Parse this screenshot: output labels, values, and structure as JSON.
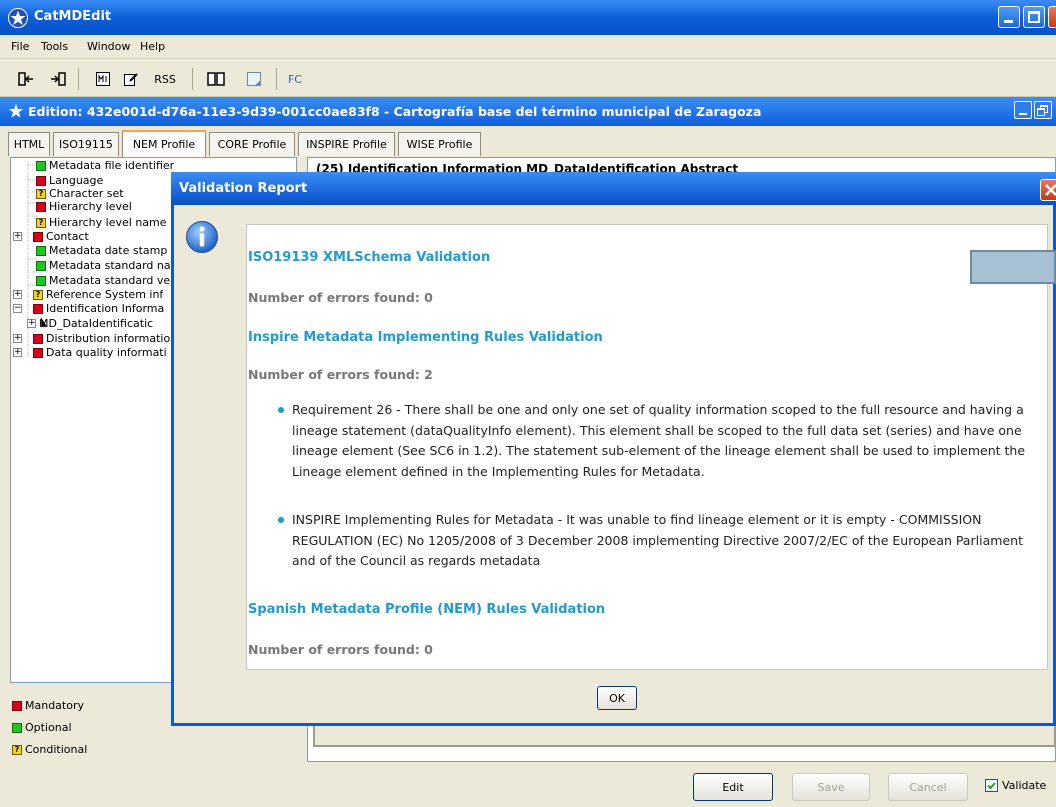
{
  "window": {
    "title": "CatMDEdit"
  },
  "menu": [
    "File",
    "Tools",
    "Window",
    "Help"
  ],
  "toolbar": {
    "rss": "RSS",
    "fc": "FC"
  },
  "edition": {
    "title": "Edition: 432e001d-d76a-11e3-9d39-001cc0ae83f8 - Cartografía base del término municipal de Zaragoza"
  },
  "tabs": [
    "HTML",
    "ISO19115",
    "NEM Profile",
    "CORE Profile",
    "INSPIRE Profile",
    "WISE Profile"
  ],
  "active_tab": "NEM Profile",
  "tree": [
    {
      "label": "Metadata file identifier",
      "status": "optional"
    },
    {
      "label": "Language",
      "status": "mandatory"
    },
    {
      "label": "Character set",
      "status": "conditional"
    },
    {
      "label": "Hierarchy level",
      "status": "mandatory"
    },
    {
      "label": "Hierarchy level name",
      "status": "conditional"
    },
    {
      "label": "Contact",
      "status": "mandatory"
    },
    {
      "label": "Metadata date stamp",
      "status": "optional"
    },
    {
      "label": "Metadata standard na",
      "status": "optional"
    },
    {
      "label": "Metadata standard ve",
      "status": "optional"
    },
    {
      "label": "Reference System inf",
      "status": "conditional"
    },
    {
      "label": "Identification Informa",
      "status": "mandatory"
    },
    {
      "label": "MD_DataIdentificatic",
      "status": "none"
    },
    {
      "label": "Distribution informatio",
      "status": "mandatory"
    },
    {
      "label": "Data quality informati",
      "status": "mandatory"
    }
  ],
  "legend": {
    "mandatory": "Mandatory",
    "optional": "Optional",
    "conditional": "Conditional"
  },
  "right_header": "(25) Identification Information MD_DataIdentification Abstract",
  "buttons": {
    "edit": "Edit",
    "save": "Save",
    "cancel": "Cancel",
    "validate": "Validate"
  },
  "dialog": {
    "title": "Validation Report",
    "sections": [
      {
        "heading": "ISO19139 XMLSchema Validation",
        "count": "Number of errors found: 0"
      },
      {
        "heading": "Inspire Metadata Implementing Rules Validation",
        "count": "Number of errors found: 2"
      },
      {
        "heading": "Spanish Metadata Profile (NEM) Rules Validation",
        "count": "Number of errors found: 0"
      }
    ],
    "errors": [
      "Requirement 26 - There shall be one and only one set of quality information scoped to the full resource and having a lineage statement (dataQualityInfo element). This element shall be scoped to the full data set (series) and have one lineage element (See SC6 in 1.2). The statement sub-element of the lineage element shall be used to implement the Lineage element defined in the Implementing Rules for Metadata.",
      "INSPIRE Implementing Rules for Metadata - It was unable to find lineage element or it is empty - COMMISSION REGULATION (EC) No 1205/2008 of 3 December 2008 implementing Directive 2007/2/EC of the European Parliament and of the Council as regards metadata"
    ],
    "ok": "OK"
  },
  "colors": {
    "titlebar": "#0a5fd8",
    "heading": "#1f9bd1",
    "mandatory": "#d9001b",
    "optional": "#22c422",
    "conditional": "#f5d21b"
  }
}
